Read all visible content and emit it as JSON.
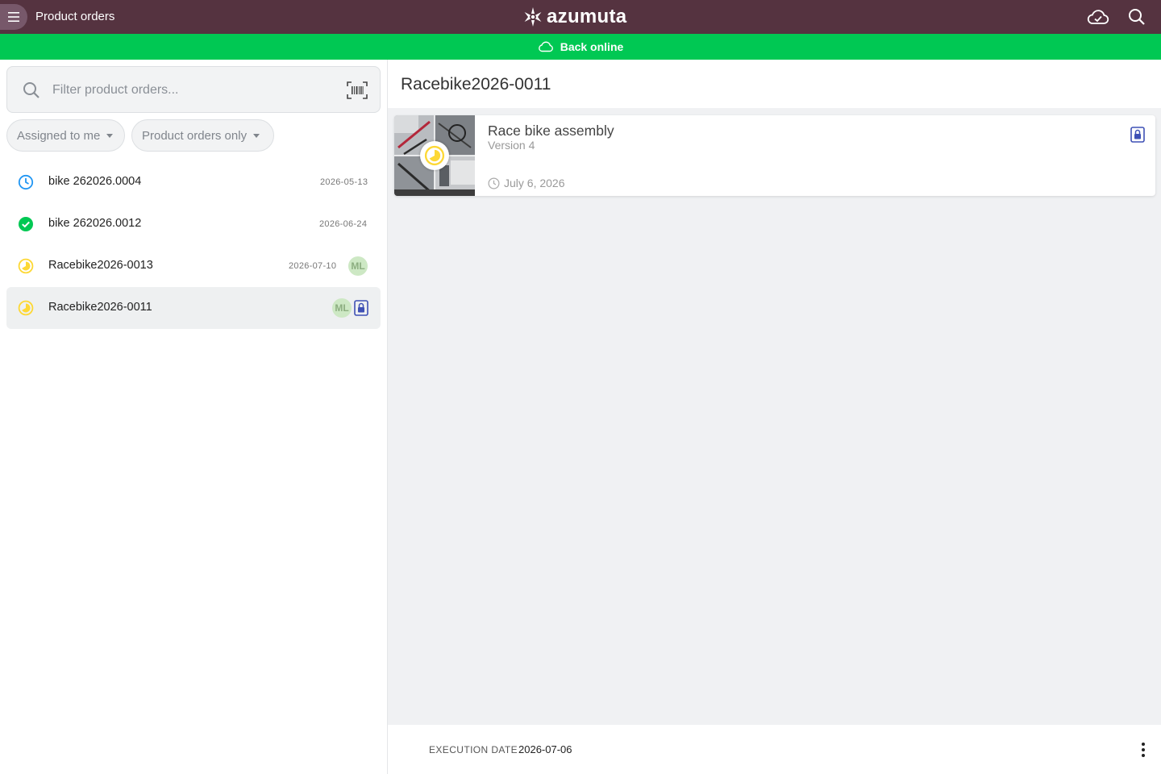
{
  "header": {
    "title": "Product orders",
    "logo_text": "azumuta",
    "bar_color": "#553340"
  },
  "banner": {
    "text": "Back online",
    "color": "#00c853"
  },
  "filter": {
    "placeholder": "Filter product orders...",
    "chips": [
      {
        "label": "Assigned to me"
      },
      {
        "label": "Product orders only"
      }
    ]
  },
  "orders": [
    {
      "name": "bike 262026.0004",
      "date": "2026-05-13",
      "status": "pending-clock-icon",
      "status_color": "#2196f3"
    },
    {
      "name": "bike 262026.0012",
      "date": "2026-06-24",
      "status": "completed-check-icon",
      "status_color": "#00c853"
    },
    {
      "name": "Racebike2026-0013",
      "date": "2026-07-10",
      "avatar": "ML",
      "status": "in-progress-icon",
      "status_color": "#fdd835"
    },
    {
      "name": "Racebike2026-0011",
      "avatar": "ML",
      "locked": true,
      "selected": true,
      "status": "in-progress-icon",
      "status_color": "#fdd835"
    }
  ],
  "detail": {
    "title": "Racebike2026-0011",
    "card": {
      "title": "Race bike assembly",
      "version": "Version 4",
      "date": "July 6, 2026"
    },
    "footer": {
      "label": "EXECUTION DATE",
      "value": "2026-07-06"
    }
  },
  "colors": {
    "lock_blue": "#3f51b5",
    "avatar_bg": "#cde8c4"
  }
}
